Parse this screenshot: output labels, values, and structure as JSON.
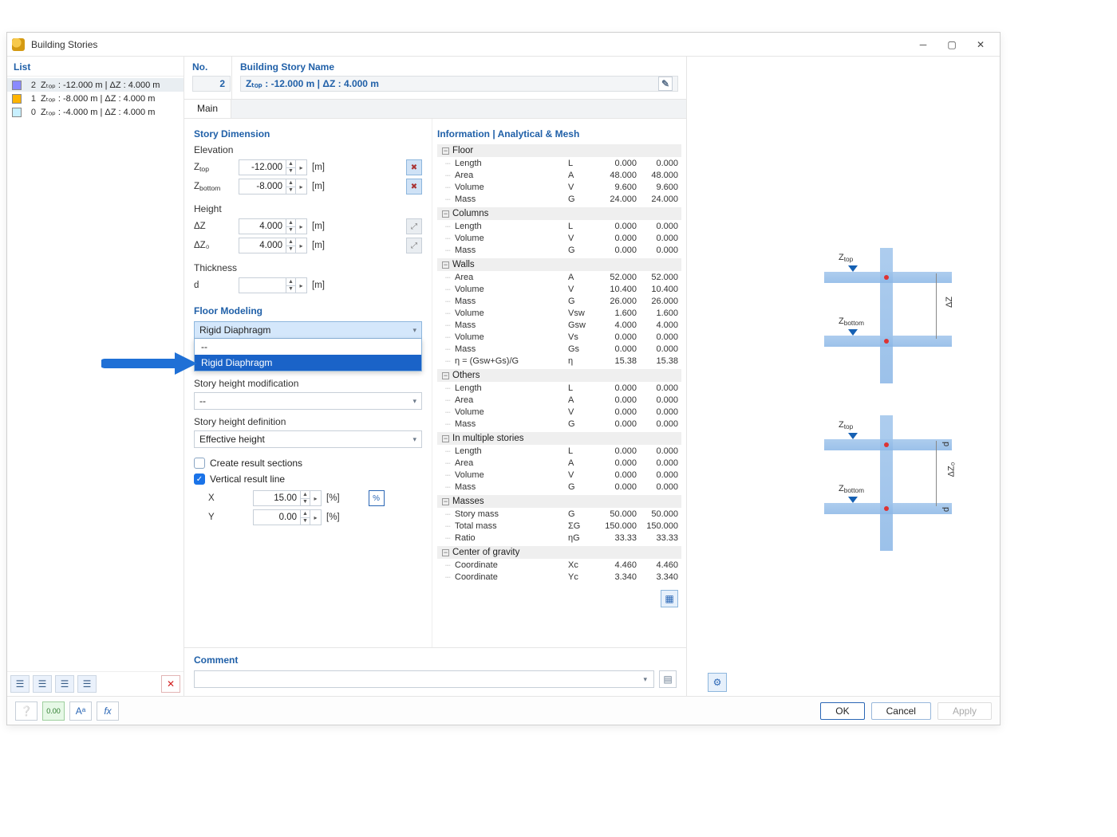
{
  "window": {
    "title": "Building Stories"
  },
  "sidebar": {
    "title": "List",
    "items": [
      {
        "num": "2",
        "color": "#8a8aff",
        "label": "Zₜₒₚ : -12.000 m | ΔZ : 4.000 m",
        "selected": true
      },
      {
        "num": "1",
        "color": "#ffb400",
        "label": "Zₜₒₚ : -8.000 m | ΔZ : 4.000 m",
        "selected": false
      },
      {
        "num": "0",
        "color": "#c8f0ff",
        "label": "Zₜₒₚ : -4.000 m | ΔZ : 4.000 m",
        "selected": false
      }
    ]
  },
  "header": {
    "no_label": "No.",
    "no_value": "2",
    "name_label": "Building Story Name",
    "name_value": "Zₜₒₚ : -12.000 m | ΔZ : 4.000 m"
  },
  "tab_main": "Main",
  "story": {
    "section": "Story Dimension",
    "elevation": "Elevation",
    "ztop": "Zₜₒₚ",
    "ztop_val": "-12.000",
    "ztop_unit": "[m]",
    "zbot": "Z_bottom",
    "zbot_val": "-8.000",
    "zbot_unit": "[m]",
    "height": "Height",
    "dz": "ΔZ",
    "dz_val": "4.000",
    "dz_unit": "[m]",
    "dz0": "ΔZ₀",
    "dz0_val": "4.000",
    "dz0_unit": "[m]",
    "thickness": "Thickness",
    "d": "d",
    "d_val": "",
    "d_unit": "[m]"
  },
  "floor": {
    "section": "Floor Modeling",
    "dd_value": "Rigid Diaphragm",
    "dd_options": [
      "--",
      "Rigid Diaphragm"
    ],
    "hmod_label": "Story height modification",
    "hmod_value": "--",
    "hdef_label": "Story height definition",
    "hdef_value": "Effective height",
    "chk_result_sections": "Create result sections",
    "chk_vertical_line": "Vertical result line",
    "x": "X",
    "x_val": "15.00",
    "x_unit": "[%]",
    "y": "Y",
    "y_val": "0.00",
    "y_unit": "[%]",
    "pct_btn": "%"
  },
  "info": {
    "title": "Information | Analytical & Mesh",
    "groups": [
      {
        "name": "Floor",
        "rows": [
          {
            "n": "Length",
            "s": "L",
            "a": "0.000",
            "b": "0.000"
          },
          {
            "n": "Area",
            "s": "A",
            "a": "48.000",
            "b": "48.000"
          },
          {
            "n": "Volume",
            "s": "V",
            "a": "9.600",
            "b": "9.600"
          },
          {
            "n": "Mass",
            "s": "G",
            "a": "24.000",
            "b": "24.000"
          }
        ]
      },
      {
        "name": "Columns",
        "rows": [
          {
            "n": "Length",
            "s": "L",
            "a": "0.000",
            "b": "0.000"
          },
          {
            "n": "Volume",
            "s": "V",
            "a": "0.000",
            "b": "0.000"
          },
          {
            "n": "Mass",
            "s": "G",
            "a": "0.000",
            "b": "0.000"
          }
        ]
      },
      {
        "name": "Walls",
        "rows": [
          {
            "n": "Area",
            "s": "A",
            "a": "52.000",
            "b": "52.000"
          },
          {
            "n": "Volume",
            "s": "V",
            "a": "10.400",
            "b": "10.400"
          },
          {
            "n": "Mass",
            "s": "G",
            "a": "26.000",
            "b": "26.000"
          },
          {
            "n": "Volume",
            "s": "Vsw",
            "a": "1.600",
            "b": "1.600"
          },
          {
            "n": "Mass",
            "s": "Gsw",
            "a": "4.000",
            "b": "4.000"
          },
          {
            "n": "Volume",
            "s": "Vs",
            "a": "0.000",
            "b": "0.000"
          },
          {
            "n": "Mass",
            "s": "Gs",
            "a": "0.000",
            "b": "0.000"
          },
          {
            "n": "η = (Gsw+Gs)/G",
            "s": "η",
            "a": "15.38",
            "b": "15.38"
          }
        ]
      },
      {
        "name": "Others",
        "rows": [
          {
            "n": "Length",
            "s": "L",
            "a": "0.000",
            "b": "0.000"
          },
          {
            "n": "Area",
            "s": "A",
            "a": "0.000",
            "b": "0.000"
          },
          {
            "n": "Volume",
            "s": "V",
            "a": "0.000",
            "b": "0.000"
          },
          {
            "n": "Mass",
            "s": "G",
            "a": "0.000",
            "b": "0.000"
          }
        ]
      },
      {
        "name": "In multiple stories",
        "rows": [
          {
            "n": "Length",
            "s": "L",
            "a": "0.000",
            "b": "0.000"
          },
          {
            "n": "Area",
            "s": "A",
            "a": "0.000",
            "b": "0.000"
          },
          {
            "n": "Volume",
            "s": "V",
            "a": "0.000",
            "b": "0.000"
          },
          {
            "n": "Mass",
            "s": "G",
            "a": "0.000",
            "b": "0.000"
          }
        ]
      },
      {
        "name": "Masses",
        "rows": [
          {
            "n": "Story mass",
            "s": "G",
            "a": "50.000",
            "b": "50.000"
          },
          {
            "n": "Total mass",
            "s": "ΣG",
            "a": "150.000",
            "b": "150.000"
          },
          {
            "n": "Ratio",
            "s": "ηG",
            "a": "33.33",
            "b": "33.33"
          }
        ]
      },
      {
        "name": "Center of gravity",
        "rows": [
          {
            "n": "Coordinate",
            "s": "Xc",
            "a": "4.460",
            "b": "4.460"
          },
          {
            "n": "Coordinate",
            "s": "Yc",
            "a": "3.340",
            "b": "3.340"
          }
        ]
      }
    ]
  },
  "diagram": {
    "ztop": "Zₜₒₚ",
    "zbot": "Z_bottom",
    "dz": "ΔZ",
    "dz0": "ΔZ₀",
    "d": "d"
  },
  "comment": {
    "label": "Comment"
  },
  "buttons": {
    "ok": "OK",
    "cancel": "Cancel",
    "apply": "Apply"
  }
}
